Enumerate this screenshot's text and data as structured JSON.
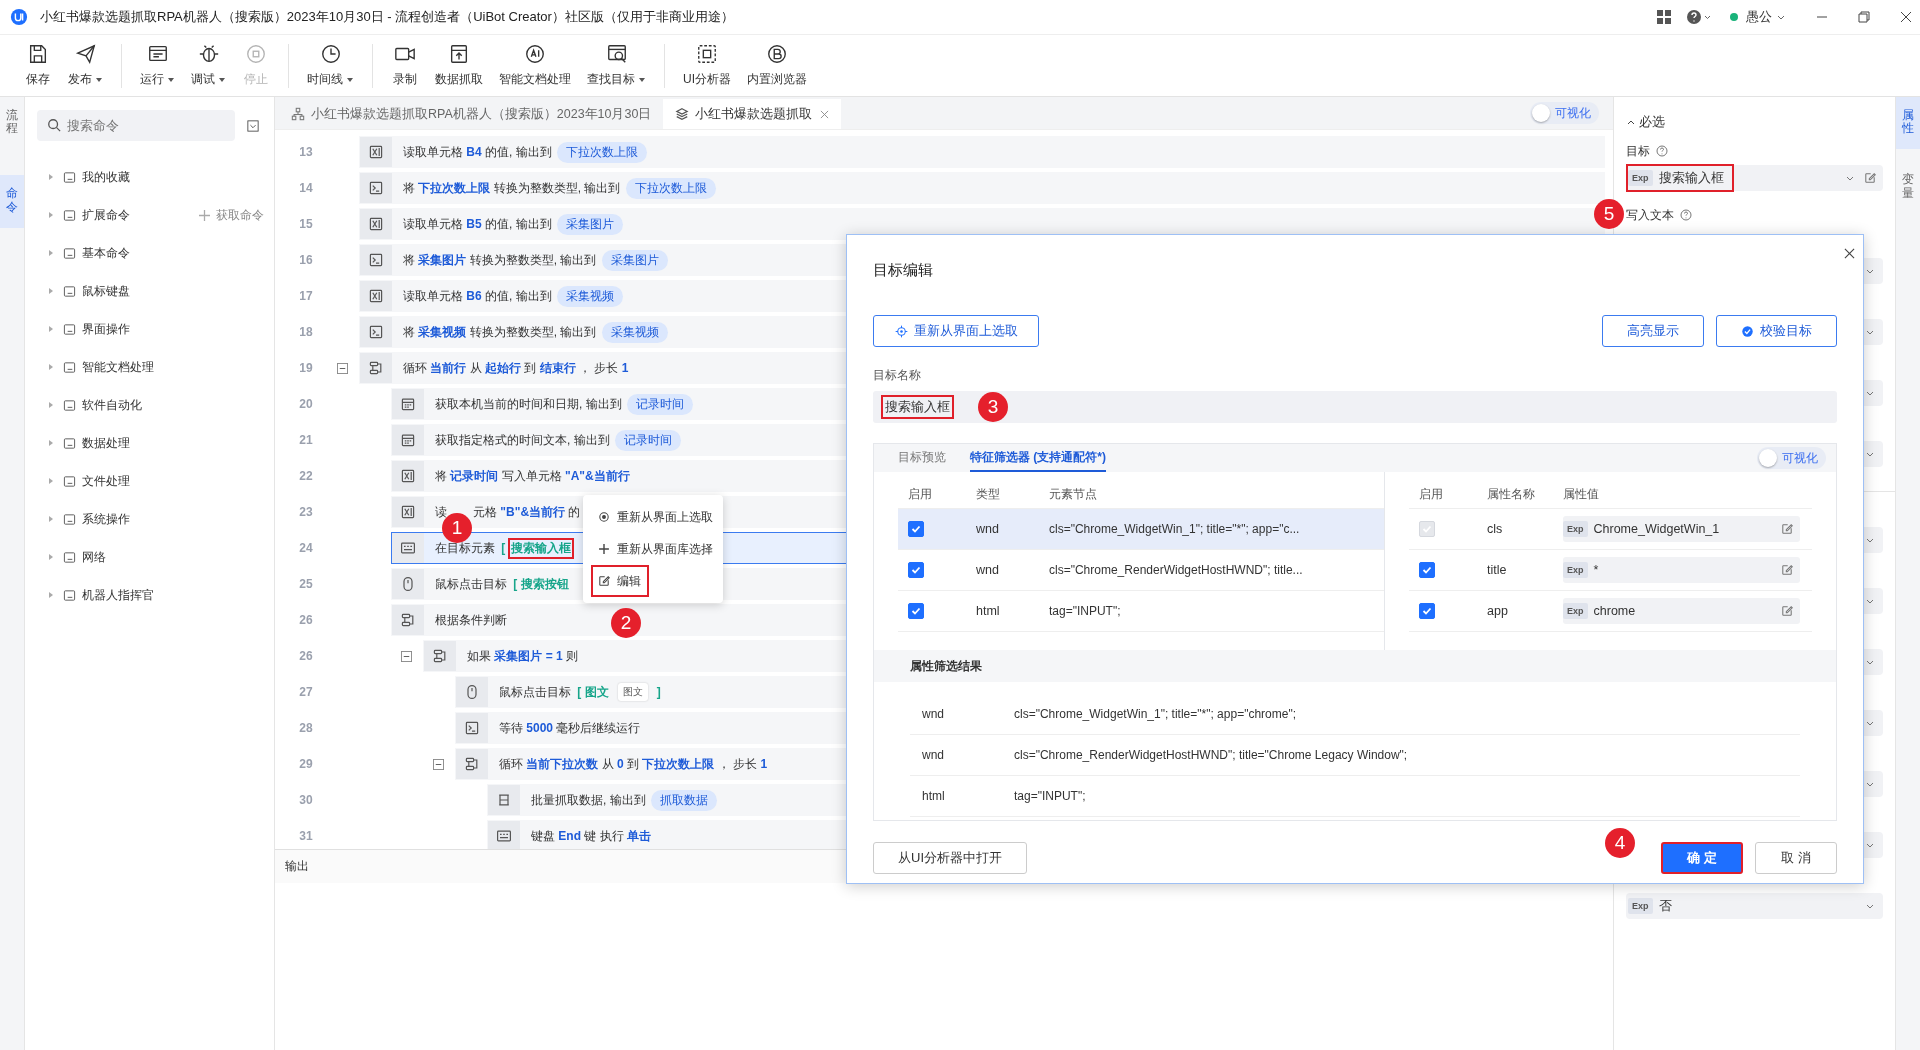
{
  "window": {
    "title": "小红书爆款选题抓取RPA机器人（搜索版）2023年10月30日 - 流程创造者（UiBot Creator）社区版（仅用于非商业用途）",
    "user": "愚公",
    "online": true
  },
  "toolbar": {
    "groups": [
      {
        "buttons": [
          {
            "label": "保存",
            "has_menu": false,
            "disabled": false
          },
          {
            "label": "发布",
            "has_menu": true,
            "disabled": false
          }
        ]
      },
      {
        "buttons": [
          {
            "label": "运行",
            "has_menu": true,
            "disabled": false
          },
          {
            "label": "调试",
            "has_menu": true,
            "disabled": false
          },
          {
            "label": "停止",
            "has_menu": false,
            "disabled": true
          }
        ]
      },
      {
        "buttons": [
          {
            "label": "时间线",
            "has_menu": true,
            "disabled": false
          }
        ]
      },
      {
        "buttons": [
          {
            "label": "录制",
            "has_menu": false,
            "disabled": false
          },
          {
            "label": "数据抓取",
            "has_menu": false,
            "disabled": false
          },
          {
            "label": "智能文档处理",
            "has_menu": false,
            "disabled": false
          },
          {
            "label": "查找目标",
            "has_menu": true,
            "disabled": false
          }
        ]
      },
      {
        "buttons": [
          {
            "label": "UI分析器",
            "has_menu": false,
            "disabled": false
          },
          {
            "label": "内置浏览器",
            "has_menu": false,
            "disabled": false
          }
        ]
      }
    ]
  },
  "left_rail": {
    "tabs": [
      {
        "label": "流程",
        "selected": false
      },
      {
        "label": "命令",
        "selected": true
      }
    ]
  },
  "command_panel": {
    "search": {
      "placeholder": "搜索命令"
    },
    "categories": [
      {
        "label": "我的收藏",
        "expanded": false
      },
      {
        "label": "扩展命令",
        "expanded": false,
        "action": "获取命令"
      },
      {
        "label": "基本命令",
        "expanded": false
      },
      {
        "label": "鼠标键盘",
        "expanded": false
      },
      {
        "label": "界面操作",
        "expanded": false
      },
      {
        "label": "智能文档处理",
        "expanded": false
      },
      {
        "label": "软件自动化",
        "expanded": false
      },
      {
        "label": "数据处理",
        "expanded": false
      },
      {
        "label": "文件处理",
        "expanded": false
      },
      {
        "label": "系统操作",
        "expanded": false
      },
      {
        "label": "网络",
        "expanded": false
      },
      {
        "label": "机器人指挥官",
        "expanded": false
      }
    ]
  },
  "editor": {
    "tabs": [
      {
        "label": "小红书爆款选题抓取RPA机器人（搜索版）2023年10月30日",
        "selected": false,
        "closable": false
      },
      {
        "label": "小红书爆款选题抓取",
        "selected": true,
        "closable": true
      }
    ],
    "visual_toggle": {
      "label": "可视化",
      "on": false
    },
    "rows": [
      {
        "line": "13",
        "kind": "excel",
        "selected": false,
        "parts": [
          {
            "text": "读取单元格 ",
            "kind": "plain"
          },
          {
            "text": "B4",
            "kind": "variable"
          },
          {
            "text": " 的值, 输出到 ",
            "kind": "plain"
          },
          {
            "text": "下拉次数上限",
            "kind": "output"
          }
        ]
      },
      {
        "line": "14",
        "kind": "convert",
        "selected": false,
        "parts": [
          {
            "text": "将 ",
            "kind": "plain"
          },
          {
            "text": "下拉次数上限",
            "kind": "variable"
          },
          {
            "text": " 转换为整数类型, 输出到 ",
            "kind": "plain"
          },
          {
            "text": "下拉次数上限",
            "kind": "output"
          }
        ]
      },
      {
        "line": "15",
        "kind": "excel",
        "selected": false,
        "parts": [
          {
            "text": "读取单元格 ",
            "kind": "plain"
          },
          {
            "text": "B5",
            "kind": "variable"
          },
          {
            "text": " 的值, 输出到 ",
            "kind": "plain"
          },
          {
            "text": "采集图片",
            "kind": "output"
          }
        ]
      },
      {
        "line": "16",
        "kind": "convert",
        "selected": false,
        "parts": [
          {
            "text": "将 ",
            "kind": "plain"
          },
          {
            "text": "采集图片",
            "kind": "variable"
          },
          {
            "text": " 转换为整数类型, 输出到 ",
            "kind": "plain"
          },
          {
            "text": "采集图片",
            "kind": "output"
          }
        ]
      },
      {
        "line": "17",
        "kind": "excel",
        "selected": false,
        "parts": [
          {
            "text": "读取单元格 ",
            "kind": "plain"
          },
          {
            "text": "B6",
            "kind": "variable"
          },
          {
            "text": " 的值, 输出到 ",
            "kind": "plain"
          },
          {
            "text": "采集视频",
            "kind": "output"
          }
        ]
      },
      {
        "line": "18",
        "kind": "convert",
        "selected": false,
        "parts": [
          {
            "text": "将 ",
            "kind": "plain"
          },
          {
            "text": "采集视频",
            "kind": "variable"
          },
          {
            "text": " 转换为整数类型, 输出到 ",
            "kind": "plain"
          },
          {
            "text": "采集视频",
            "kind": "output"
          }
        ]
      },
      {
        "line": "19",
        "kind": "loop",
        "selected": false,
        "expanded": true,
        "parts": [
          {
            "text": "循环 ",
            "kind": "plain"
          },
          {
            "text": "当前行",
            "kind": "variable"
          },
          {
            "text": " 从 ",
            "kind": "plain"
          },
          {
            "text": "起始行",
            "kind": "variable"
          },
          {
            "text": " 到 ",
            "kind": "plain"
          },
          {
            "text": "结束行",
            "kind": "variable"
          },
          {
            "text": " ， 步长 ",
            "kind": "plain"
          },
          {
            "text": "1",
            "kind": "variable"
          }
        ],
        "children": [
          {
            "line": "20",
            "kind": "datetime",
            "selected": false,
            "parts": [
              {
                "text": "获取本机当前的时间和日期, 输出到 ",
                "kind": "plain"
              },
              {
                "text": "记录时间",
                "kind": "output"
              }
            ]
          },
          {
            "line": "21",
            "kind": "datetime",
            "selected": false,
            "parts": [
              {
                "text": "获取指定格式的时间文本, 输出到 ",
                "kind": "plain"
              },
              {
                "text": "记录时间",
                "kind": "output"
              }
            ]
          },
          {
            "line": "22",
            "kind": "excel",
            "selected": false,
            "parts": [
              {
                "text": "将 ",
                "kind": "plain"
              },
              {
                "text": "记录时间",
                "kind": "variable"
              },
              {
                "text": " 写入单元格 ",
                "kind": "plain"
              },
              {
                "text": "\"A\"&当前行",
                "kind": "variable"
              }
            ]
          },
          {
            "line": "23",
            "kind": "excel",
            "selected": false,
            "parts": [
              {
                "text": "读",
                "kind": "plain"
              },
              {
                "text": "元格 ",
                "kind": "plain",
                "after_cover": true
              },
              {
                "text": "\"B\"&当前行",
                "kind": "variable"
              },
              {
                "text": " 的",
                "kind": "plain"
              }
            ]
          },
          {
            "line": "24",
            "kind": "keyboard",
            "selected": true,
            "parts": [
              {
                "text": "在目标元素 ",
                "kind": "plain"
              },
              {
                "text": "[",
                "kind": "target"
              },
              {
                "text": "搜索输入框",
                "kind": "target",
                "highlighted": true
              }
            ]
          },
          {
            "line": "25",
            "kind": "mouse",
            "selected": false,
            "parts": [
              {
                "text": "鼠标点击目标 ",
                "kind": "plain"
              },
              {
                "text": "[ 搜索按钮",
                "kind": "target"
              }
            ]
          },
          {
            "line": "26",
            "kind": "condition",
            "selected": false,
            "parts": [
              {
                "text": "根据条件判断",
                "kind": "plain"
              }
            ],
            "children": [
              {
                "line": "26",
                "kind": "condition",
                "selected": false,
                "expanded": true,
                "parts": [
                  {
                    "text": "如果 ",
                    "kind": "plain"
                  },
                  {
                    "text": "采集图片",
                    "kind": "variable"
                  },
                  {
                    "text": " = ",
                    "kind": "variable"
                  },
                  {
                    "text": "1",
                    "kind": "variable"
                  },
                  {
                    "text": " 则",
                    "kind": "plain"
                  }
                ],
                "children": [
                  {
                    "line": "27",
                    "kind": "mouse",
                    "selected": false,
                    "parts": [
                      {
                        "text": "鼠标点击目标 ",
                        "kind": "plain"
                      },
                      {
                        "text": "[ 图文",
                        "kind": "target"
                      },
                      {
                        "text": "图文",
                        "kind": "thumbnail"
                      },
                      {
                        "text": "]",
                        "kind": "target"
                      }
                    ]
                  },
                  {
                    "line": "28",
                    "kind": "convert",
                    "selected": false,
                    "parts": [
                      {
                        "text": "等待 ",
                        "kind": "plain"
                      },
                      {
                        "text": "5000",
                        "kind": "variable"
                      },
                      {
                        "text": " 毫秒后继续运行",
                        "kind": "plain"
                      }
                    ]
                  },
                  {
                    "line": "29",
                    "kind": "loop",
                    "selected": false,
                    "expanded": true,
                    "parts": [
                      {
                        "text": "循环 ",
                        "kind": "plain"
                      },
                      {
                        "text": "当前下拉次数",
                        "kind": "variable"
                      },
                      {
                        "text": " 从 ",
                        "kind": "plain"
                      },
                      {
                        "text": "0",
                        "kind": "variable"
                      },
                      {
                        "text": " 到 ",
                        "kind": "plain"
                      },
                      {
                        "text": "下拉次数上限",
                        "kind": "variable"
                      },
                      {
                        "text": " ， 步长 ",
                        "kind": "plain"
                      },
                      {
                        "text": "1",
                        "kind": "variable"
                      }
                    ],
                    "children": [
                      {
                        "line": "30",
                        "kind": "scrape",
                        "selected": false,
                        "parts": [
                          {
                            "text": "批量抓取数据, 输出到 ",
                            "kind": "plain"
                          },
                          {
                            "text": "抓取数据",
                            "kind": "output"
                          }
                        ]
                      },
                      {
                        "line": "31",
                        "kind": "keyboard",
                        "selected": false,
                        "parts": [
                          {
                            "text": "键盘 ",
                            "kind": "plain"
                          },
                          {
                            "text": "End",
                            "kind": "variable"
                          },
                          {
                            "text": " 键 执行 ",
                            "kind": "plain"
                          },
                          {
                            "text": "单击",
                            "kind": "variable"
                          }
                        ]
                      }
                    ]
                  }
                ]
              }
            ]
          }
        ]
      }
    ],
    "output_tab": "输出"
  },
  "context_menu": {
    "items": [
      {
        "label": "重新从界面上选取",
        "highlighted": false
      },
      {
        "label": "重新从界面库选择",
        "highlighted": false
      },
      {
        "label": "编辑",
        "highlighted": true
      }
    ]
  },
  "markers": [
    {
      "number": "1"
    },
    {
      "number": "2"
    },
    {
      "number": "5"
    }
  ],
  "dialog": {
    "title": "目标编辑",
    "reselect_button": "重新从界面上选取",
    "highlight_button": "高亮显示",
    "validate_button": "校验目标",
    "name_label": "目标名称",
    "name_value": "搜索输入框",
    "name_highlighted": true,
    "name_marker": "3",
    "tabs": [
      {
        "label": "目标预览",
        "selected": false
      },
      {
        "label": "特征筛选器 (支持通配符*)",
        "selected": true
      }
    ],
    "visual_toggle": {
      "label": "可视化",
      "on": false
    },
    "node_table": {
      "columns": [
        "启用",
        "类型",
        "元素节点"
      ],
      "rows": [
        {
          "checked": true,
          "selected": true,
          "type": "wnd",
          "node": "cls=\"Chrome_WidgetWin_1\"; title=\"*\"; app=\"c..."
        },
        {
          "checked": true,
          "selected": false,
          "type": "wnd",
          "node": "cls=\"Chrome_RenderWidgetHostHWND\"; title..."
        },
        {
          "checked": true,
          "selected": false,
          "type": "html",
          "node": "tag=\"INPUT\";"
        }
      ]
    },
    "attr_table": {
      "columns": [
        "启用",
        "属性名称",
        "属性值"
      ],
      "rows": [
        {
          "checked": true,
          "disabled": true,
          "name": "cls",
          "tag": "Exp",
          "value": "Chrome_WidgetWin_1"
        },
        {
          "checked": true,
          "disabled": false,
          "name": "title",
          "tag": "Exp",
          "value": "*"
        },
        {
          "checked": true,
          "disabled": false,
          "name": "app",
          "tag": "Exp",
          "value": "chrome"
        }
      ]
    },
    "result_title": "属性筛选结果",
    "results": [
      {
        "type": "wnd",
        "value": "cls=\"Chrome_WidgetWin_1\"; title=\"*\"; app=\"chrome\";"
      },
      {
        "type": "wnd",
        "value": "cls=\"Chrome_RenderWidgetHostHWND\"; title=\"Chrome Legacy Window\";"
      },
      {
        "type": "html",
        "value": "tag=\"INPUT\";"
      }
    ],
    "open_analyzer_button": "从UI分析器中打开",
    "footer_marker": "4",
    "confirm_button": {
      "label": "确 定",
      "highlighted": true
    },
    "cancel_button": "取 消"
  },
  "properties": {
    "section": {
      "label": "必选",
      "expanded": true
    },
    "target": {
      "label": "目标",
      "tag": "Exp",
      "value": "搜索输入框",
      "highlighted": true
    },
    "write_text": {
      "label": "写入文本"
    },
    "last_field": {
      "tag": "Exp",
      "value": "否"
    }
  },
  "right_rail": {
    "tabs": [
      {
        "label": "属性",
        "selected": true
      },
      {
        "label": "变量",
        "selected": false
      }
    ]
  }
}
